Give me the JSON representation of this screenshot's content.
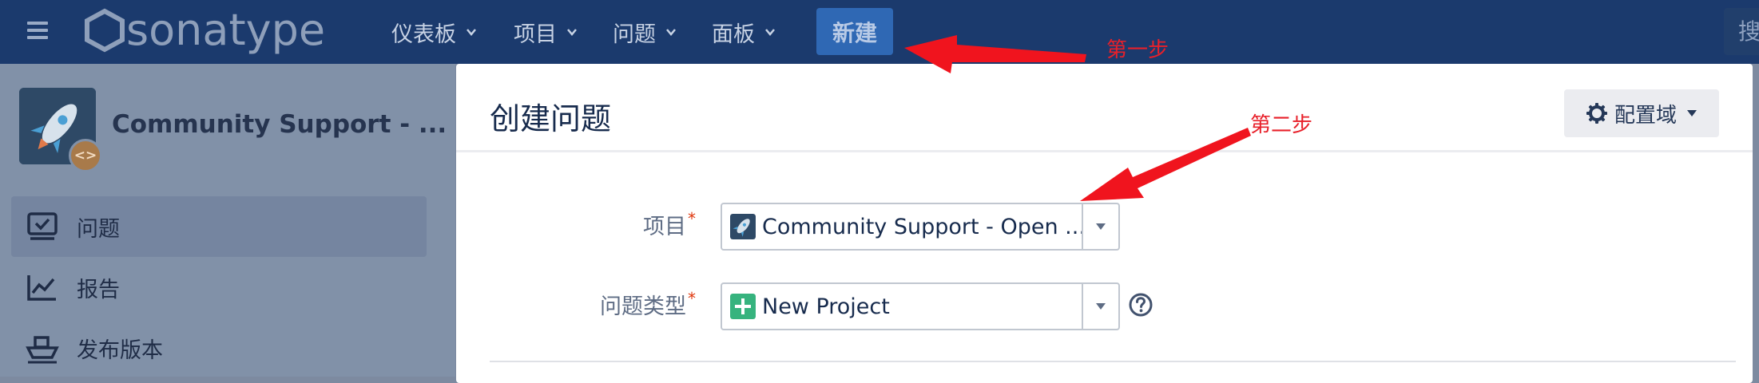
{
  "topbar": {
    "logo_text": "sonatype",
    "nav": [
      {
        "label": "仪表板"
      },
      {
        "label": "项目"
      },
      {
        "label": "问题"
      },
      {
        "label": "面板"
      }
    ],
    "create_label": "新建",
    "search_placeholder": "搜"
  },
  "sidebar": {
    "project_name": "Community Support - ...",
    "project_badge": "<>",
    "items": [
      {
        "label": "问题",
        "active": true
      },
      {
        "label": "报告"
      },
      {
        "label": "发布版本"
      }
    ]
  },
  "modal": {
    "title": "创建问题",
    "config_label": "配置域",
    "fields": [
      {
        "label": "项目",
        "required": "*",
        "value": "Community Support - Open ..."
      },
      {
        "label": "问题类型",
        "required": "*",
        "value": "New Project"
      }
    ]
  },
  "annotations": {
    "step1": "第一步",
    "step2": "第二步",
    "color": "#e8202a"
  },
  "colors": {
    "topbar": "#1b3a6d",
    "create_button": "#2f68b4",
    "modal_bg": "#ffffff",
    "required": "#de350b",
    "issue_type_icon": "#36b37e"
  }
}
